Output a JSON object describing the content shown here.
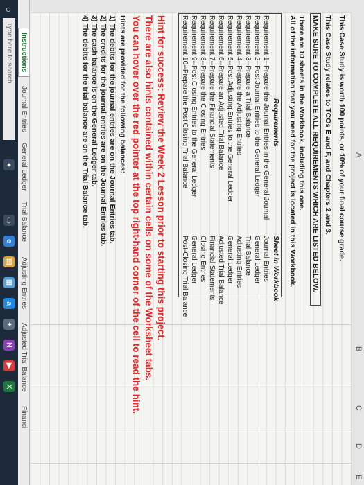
{
  "columns": [
    "A",
    "B",
    "C",
    "D",
    "E"
  ],
  "intro": {
    "line1": "This Case Study is worth 100 points, or 10% of your final course grade.",
    "line2": "This Case Study relates to TCOs E and F, and Chapters 2 and 3.",
    "line3": "MAKE SURE TO COMPLETE ALL REQUIREMENTS WHICH ARE LISTED BELOW.",
    "line4": "There are 10 sheets in the Workbook, including this one.",
    "line5": "All of the information that you need for the project is located in this Workbook."
  },
  "table": {
    "header_req": "Requirements",
    "header_sheet": "Sheet in Workbook",
    "requirements": [
      "Requirement 1--Prepare the Journal Entries in the General Journal",
      "Requirement 2--Post Journal Entries to the General Ledger",
      "Requirement 3--Prepare a Trial Balance",
      "Requirement 4--Prepare the Adjusting Entries",
      "Requirement 5--Post Adjusting Entries to the General Ledger",
      "Requirement 6--Prepare an Adjusted Trial Balance",
      "Requirement 7--Prepare the Financial Statements",
      "Requirement 8--Prepare the Closing Entries",
      "Requirement 9--Post Closing Entries to the General Ledger",
      "Requirement 10--Prepare the Post Closing Trial Balance"
    ],
    "sheets": [
      "Journal Entries",
      "General Ledger",
      "Trial Balance",
      "Adjusting Entries",
      "General Ledger",
      "Adjusted Trial Balance",
      "Financial Statements",
      "Closing Entries",
      "General Ledger",
      "Post-Closing Trial Balance"
    ]
  },
  "hints": {
    "red1": "Hint for success: Review the Week 2 Lesson prior to starting this project.",
    "red2": "There are also hints contained within certain cells on some of the Worksheet tabs.",
    "red3": "You can hover over the red pointer at the top right-hand corner of the cell to read the hint.",
    "provided": "Hints are provided for the following balances:",
    "list": [
      "1) The debits for the journal entries are on the Journal Entries tab.",
      "2) The credits for the journal entries are on the Journal Entries tab.",
      "3) The cash balance is on the General Ledger tab.",
      "4) The debits for the trial balance are on the Trial Balance tab."
    ]
  },
  "tabs": [
    "Instructions",
    "Journal Entries",
    "General Ledger",
    "Trial Balance",
    "Adjusting Entries",
    "Adjusted Trial Balance",
    "Financi"
  ],
  "taskbar": {
    "search_placeholder": "Type here to search"
  }
}
